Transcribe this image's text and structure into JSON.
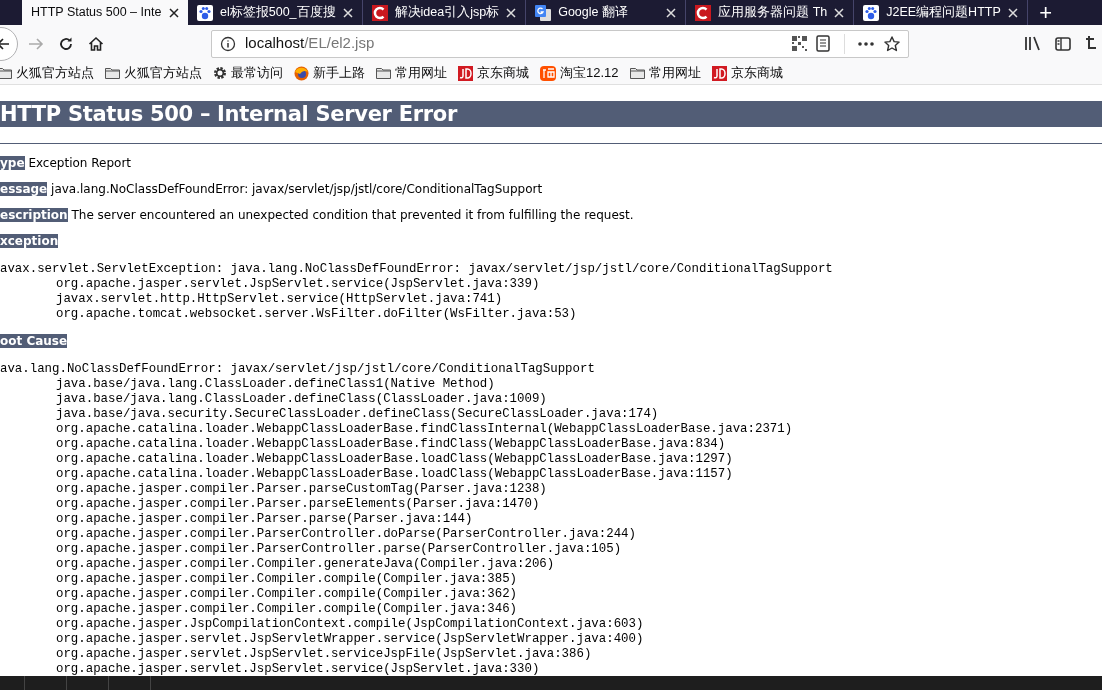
{
  "tabs": [
    {
      "title": "HTTP Status 500 – Inte",
      "selected": true
    },
    {
      "title": "el标签报500_百度搜",
      "kind": "paw",
      "selected": false
    },
    {
      "title": "解决idea引入jsp标",
      "kind": "c",
      "selected": false
    },
    {
      "title": "Google 翻译",
      "kind": "g",
      "selected": false
    },
    {
      "title": "应用服务器问题 Th",
      "kind": "c",
      "selected": false
    },
    {
      "title": "J2EE编程问题HTTP",
      "kind": "paw",
      "selected": false
    }
  ],
  "new_tab": "+",
  "address_bar": {
    "host": "localhost",
    "path": "/EL/el2.jsp"
  },
  "bookmarks": [
    {
      "label": "火狐官方站点",
      "kind": "folder"
    },
    {
      "label": "火狐官方站点",
      "kind": "folder"
    },
    {
      "label": "最常访问",
      "kind": "gear"
    },
    {
      "label": "新手上路",
      "kind": "firefox"
    },
    {
      "label": "常用网址",
      "kind": "folder"
    },
    {
      "label": "京东商城",
      "kind": "jd"
    },
    {
      "label": "淘宝12.12",
      "kind": "taobao"
    },
    {
      "label": "常用网址",
      "kind": "folder"
    },
    {
      "label": "京东商城",
      "kind": "jd"
    }
  ],
  "page": {
    "title": "HTTP Status 500 – Internal Server Error",
    "fields": [
      {
        "label": "ype",
        "value": "Exception Report"
      },
      {
        "label": "essage",
        "value": "java.lang.NoClassDefFoundError: javax/servlet/jsp/jstl/core/ConditionalTagSupport"
      },
      {
        "label": "escription",
        "value": "The server encountered an unexpected condition that prevented it from fulfilling the request."
      }
    ],
    "sections": [
      {
        "label": "xception",
        "first_line": "avax.servlet.ServletException: java.lang.NoClassDefFoundError: javax/servlet/jsp/jstl/core/ConditionalTagSupport",
        "frames": [
          "org.apache.jasper.servlet.JspServlet.service(JspServlet.java:339)",
          "javax.servlet.http.HttpServlet.service(HttpServlet.java:741)",
          "org.apache.tomcat.websocket.server.WsFilter.doFilter(WsFilter.java:53)"
        ]
      },
      {
        "label": "oot Cause",
        "first_line": "ava.lang.NoClassDefFoundError: javax/servlet/jsp/jstl/core/ConditionalTagSupport",
        "frames": [
          "java.base/java.lang.ClassLoader.defineClass1(Native Method)",
          "java.base/java.lang.ClassLoader.defineClass(ClassLoader.java:1009)",
          "java.base/java.security.SecureClassLoader.defineClass(SecureClassLoader.java:174)",
          "org.apache.catalina.loader.WebappClassLoaderBase.findClassInternal(WebappClassLoaderBase.java:2371)",
          "org.apache.catalina.loader.WebappClassLoaderBase.findClass(WebappClassLoaderBase.java:834)",
          "org.apache.catalina.loader.WebappClassLoaderBase.loadClass(WebappClassLoaderBase.java:1297)",
          "org.apache.catalina.loader.WebappClassLoaderBase.loadClass(WebappClassLoaderBase.java:1157)",
          "org.apache.jasper.compiler.Parser.parseCustomTag(Parser.java:1238)",
          "org.apache.jasper.compiler.Parser.parseElements(Parser.java:1470)",
          "org.apache.jasper.compiler.Parser.parse(Parser.java:144)",
          "org.apache.jasper.compiler.ParserController.doParse(ParserController.java:244)",
          "org.apache.jasper.compiler.ParserController.parse(ParserController.java:105)",
          "org.apache.jasper.compiler.Compiler.generateJava(Compiler.java:206)",
          "org.apache.jasper.compiler.Compiler.compile(Compiler.java:385)",
          "org.apache.jasper.compiler.Compiler.compile(Compiler.java:362)",
          "org.apache.jasper.compiler.Compiler.compile(Compiler.java:346)",
          "org.apache.jasper.JspCompilationContext.compile(JspCompilationContext.java:603)",
          "org.apache.jasper.servlet.JspServletWrapper.service(JspServletWrapper.java:400)",
          "org.apache.jasper.servlet.JspServlet.serviceJspFile(JspServlet.java:386)",
          "org.apache.jasper.servlet.JspServlet.service(JspServlet.java:330)"
        ]
      }
    ]
  }
}
